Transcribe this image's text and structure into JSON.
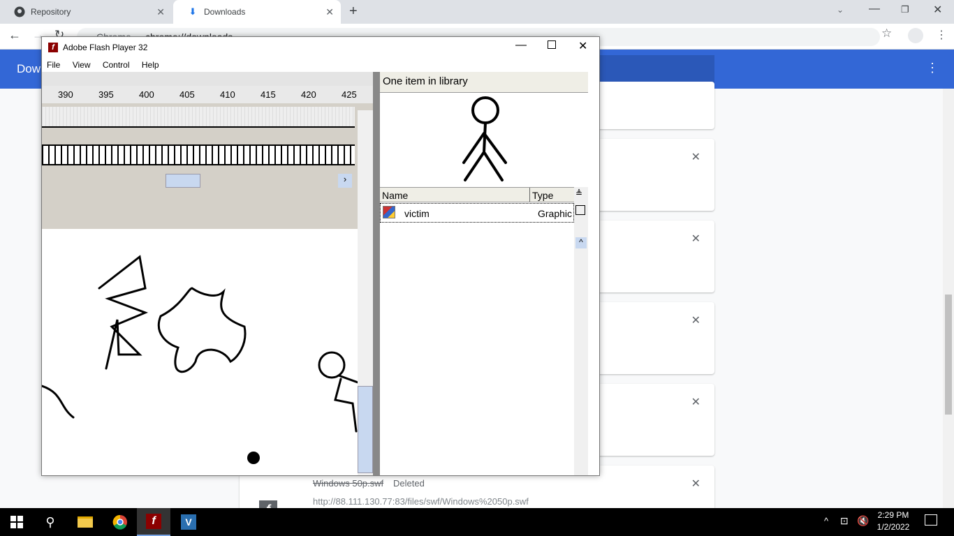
{
  "browser": {
    "tabs": [
      {
        "label": "Repository"
      },
      {
        "label": "Downloads"
      }
    ],
    "address": "chrome://downloads",
    "omnibox_prefix": "Chrome",
    "header_title": "Down"
  },
  "downloads": {
    "last_item": {
      "filename": "Windows 50p.swf",
      "status": "Deleted",
      "url": "http://88.111.130.77:83/files/swf/Windows%2050p.swf"
    }
  },
  "flash": {
    "title": "Adobe Flash Player 32",
    "menu": [
      "File",
      "View",
      "Control",
      "Help"
    ],
    "ruler": [
      "390",
      "395",
      "400",
      "405",
      "410",
      "415",
      "420",
      "425"
    ],
    "library": {
      "count_label": "One item in library",
      "col_name": "Name",
      "col_type": "Type",
      "items": [
        {
          "name": "victim",
          "type": "Graphic"
        }
      ]
    }
  },
  "taskbar": {
    "time": "2:29 PM",
    "date": "1/2/2022"
  }
}
